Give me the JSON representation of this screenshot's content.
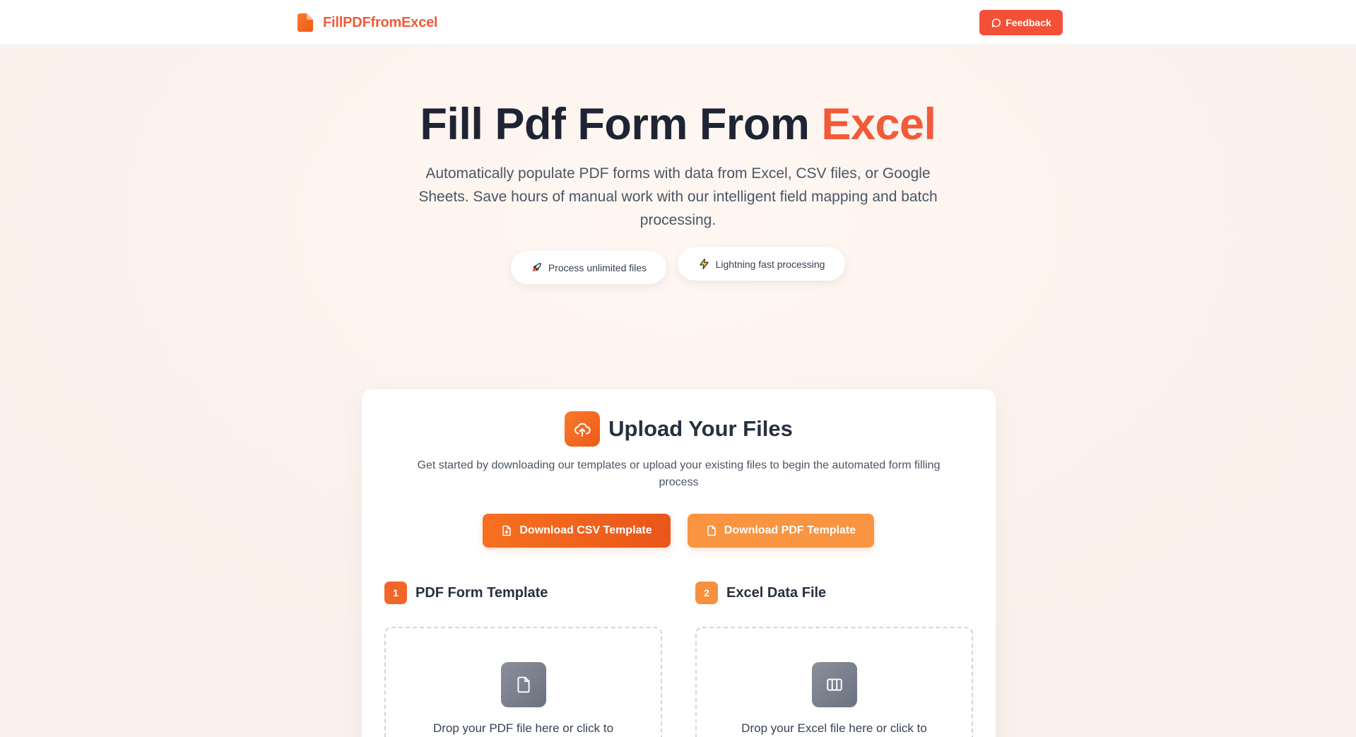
{
  "header": {
    "brand_name": "FillPDFfromExcel",
    "brand_icon": "file-icon",
    "feedback_label": "Feedback",
    "feedback_icon": "chat-bubble-icon"
  },
  "hero": {
    "title_main": "Fill Pdf Form From ",
    "title_accent": "Excel",
    "subtitle": "Automatically populate PDF forms with data from Excel, CSV files, or Google Sheets. Save hours of manual work with our intelligent field mapping and batch processing.",
    "pills": [
      {
        "label": "Process unlimited files",
        "icon": "rocket-icon"
      },
      {
        "label": "Lightning fast processing",
        "icon": "lightning-icon"
      }
    ]
  },
  "upload": {
    "title": "Upload Your Files",
    "icon": "cloud-upload-icon",
    "description": "Get started by downloading our templates or upload your existing files to begin the automated form filling process",
    "download_csv_label": "Download CSV Template",
    "download_pdf_label": "Download PDF Template",
    "steps": [
      {
        "number": "1",
        "label": "PDF Form Template",
        "drop_text": "Drop your PDF file here or click to"
      },
      {
        "number": "2",
        "label": "Excel Data File",
        "drop_text": "Drop your Excel file here or click to"
      }
    ]
  },
  "colors": {
    "brand": "#f25a38",
    "accent_orange": "#f7701f",
    "light_orange": "#f99440",
    "text_dark": "#1e2433"
  }
}
